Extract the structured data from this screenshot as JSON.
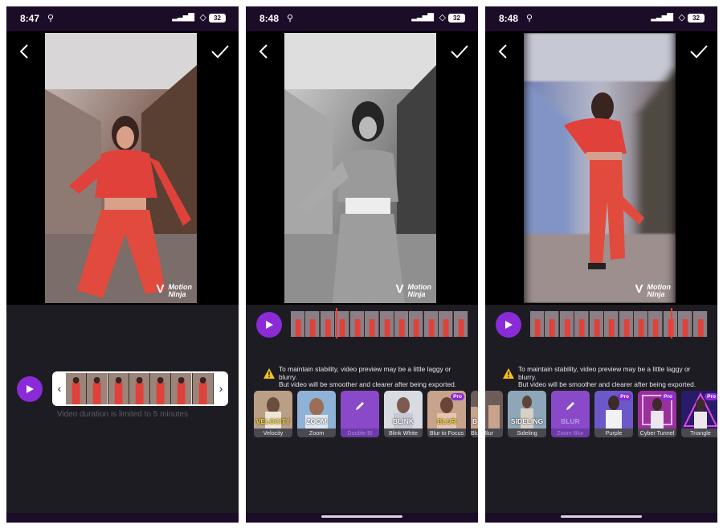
{
  "screens": [
    {
      "status": {
        "time": "8:47",
        "battery": "32"
      },
      "play_icon": "play-icon",
      "trim_caption": "Video duration is limited to 5 minutes",
      "watermark": {
        "line1": "Motion",
        "line2": "Ninja"
      }
    },
    {
      "status": {
        "time": "8:48",
        "battery": "32"
      },
      "notice": {
        "line1": "To maintain stability, video preview may be a little laggy or blurry.",
        "line2": "But video will be smoother and clearer after being exported."
      },
      "watermark": {
        "line1": "Motion",
        "line2": "Ninja"
      },
      "effects": [
        {
          "label": "Velocity",
          "overlay": "VELOCITY"
        },
        {
          "label": "Zoom",
          "overlay": "ZOOM"
        },
        {
          "label": "Double Bl",
          "overlay": "",
          "selected": true
        },
        {
          "label": "Blink White",
          "overlay": "BLINK"
        },
        {
          "label": "Blur to Focus",
          "overlay": "BLUR",
          "pro": "Pro"
        },
        {
          "label": "Blur",
          "overlay": "B"
        }
      ]
    },
    {
      "status": {
        "time": "8:48",
        "battery": "32"
      },
      "notice": {
        "line1": "To maintain stability, video preview may be a little laggy or blurry.",
        "line2": "But video will be smoother and clearer after being exported."
      },
      "watermark": {
        "line1": "Motion",
        "line2": "Ninja"
      },
      "effects": [
        {
          "label": "Blur",
          "overlay": ""
        },
        {
          "label": "Sideling",
          "overlay": "SIDELING"
        },
        {
          "label": "Zoom Blur",
          "overlay": "BLUR",
          "selected": true
        },
        {
          "label": "Purple",
          "overlay": "",
          "pro": "Pro"
        },
        {
          "label": "Cyber Tunnel",
          "overlay": "",
          "pro": "Pro"
        },
        {
          "label": "Triangle",
          "overlay": "",
          "pro": "Pro"
        }
      ]
    }
  ],
  "colors": {
    "accent": "#8a2bd7",
    "status_bar": "#1b0c28",
    "panel": "#1d1c22",
    "playhead": "#ff3b30"
  },
  "icons": {
    "back": "chevron-left-icon",
    "confirm": "checkmark-icon",
    "warning": "warning-icon",
    "play": "play-icon"
  }
}
